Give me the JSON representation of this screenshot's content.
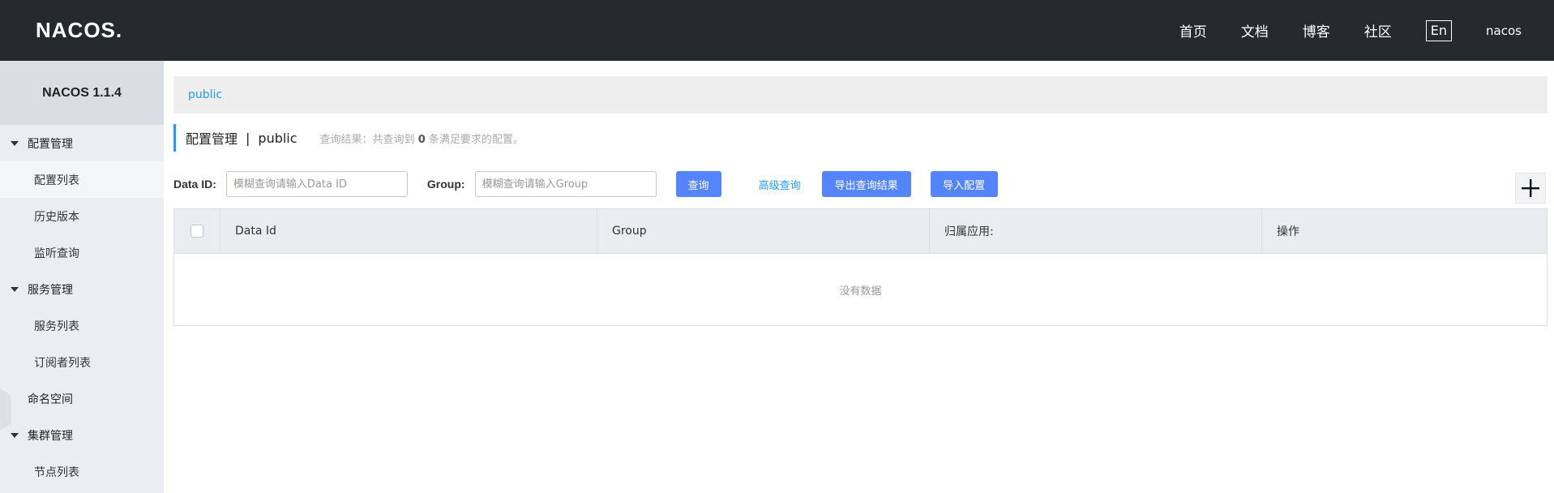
{
  "header": {
    "logo": "NACOS.",
    "nav": [
      "首页",
      "文档",
      "博客",
      "社区"
    ],
    "lang": "En",
    "user": "nacos"
  },
  "sidebar": {
    "version": "NACOS 1.1.4",
    "config_group": "配置管理",
    "config_items": [
      "配置列表",
      "历史版本",
      "监听查询"
    ],
    "service_group": "服务管理",
    "service_items": [
      "服务列表",
      "订阅者列表"
    ],
    "namespace": "命名空间",
    "cluster_group": "集群管理",
    "cluster_items": [
      "节点列表"
    ]
  },
  "namespace_bar": {
    "current": "public"
  },
  "title": {
    "main": "配置管理",
    "separator": "|",
    "namespace": "public",
    "hint_prefix": "查询结果：共查询到",
    "hint_count": "0",
    "hint_suffix": "条满足要求的配置。"
  },
  "filters": {
    "data_id_label": "Data ID:",
    "data_id_placeholder": "模糊查询请输入Data ID",
    "group_label": "Group:",
    "group_placeholder": "模糊查询请输入Group",
    "search_button": "查询",
    "advanced_search": "高级查询",
    "export_button": "导出查询结果",
    "import_button": "导入配置"
  },
  "table": {
    "columns": [
      "Data Id",
      "Group",
      "归属应用:",
      "操作"
    ],
    "empty_text": "没有数据"
  },
  "colors": {
    "header_bg": "#252a2f",
    "sidebar_bg": "#eaedf1",
    "accent": "#209bfa",
    "primary_button": "#5584ff"
  }
}
